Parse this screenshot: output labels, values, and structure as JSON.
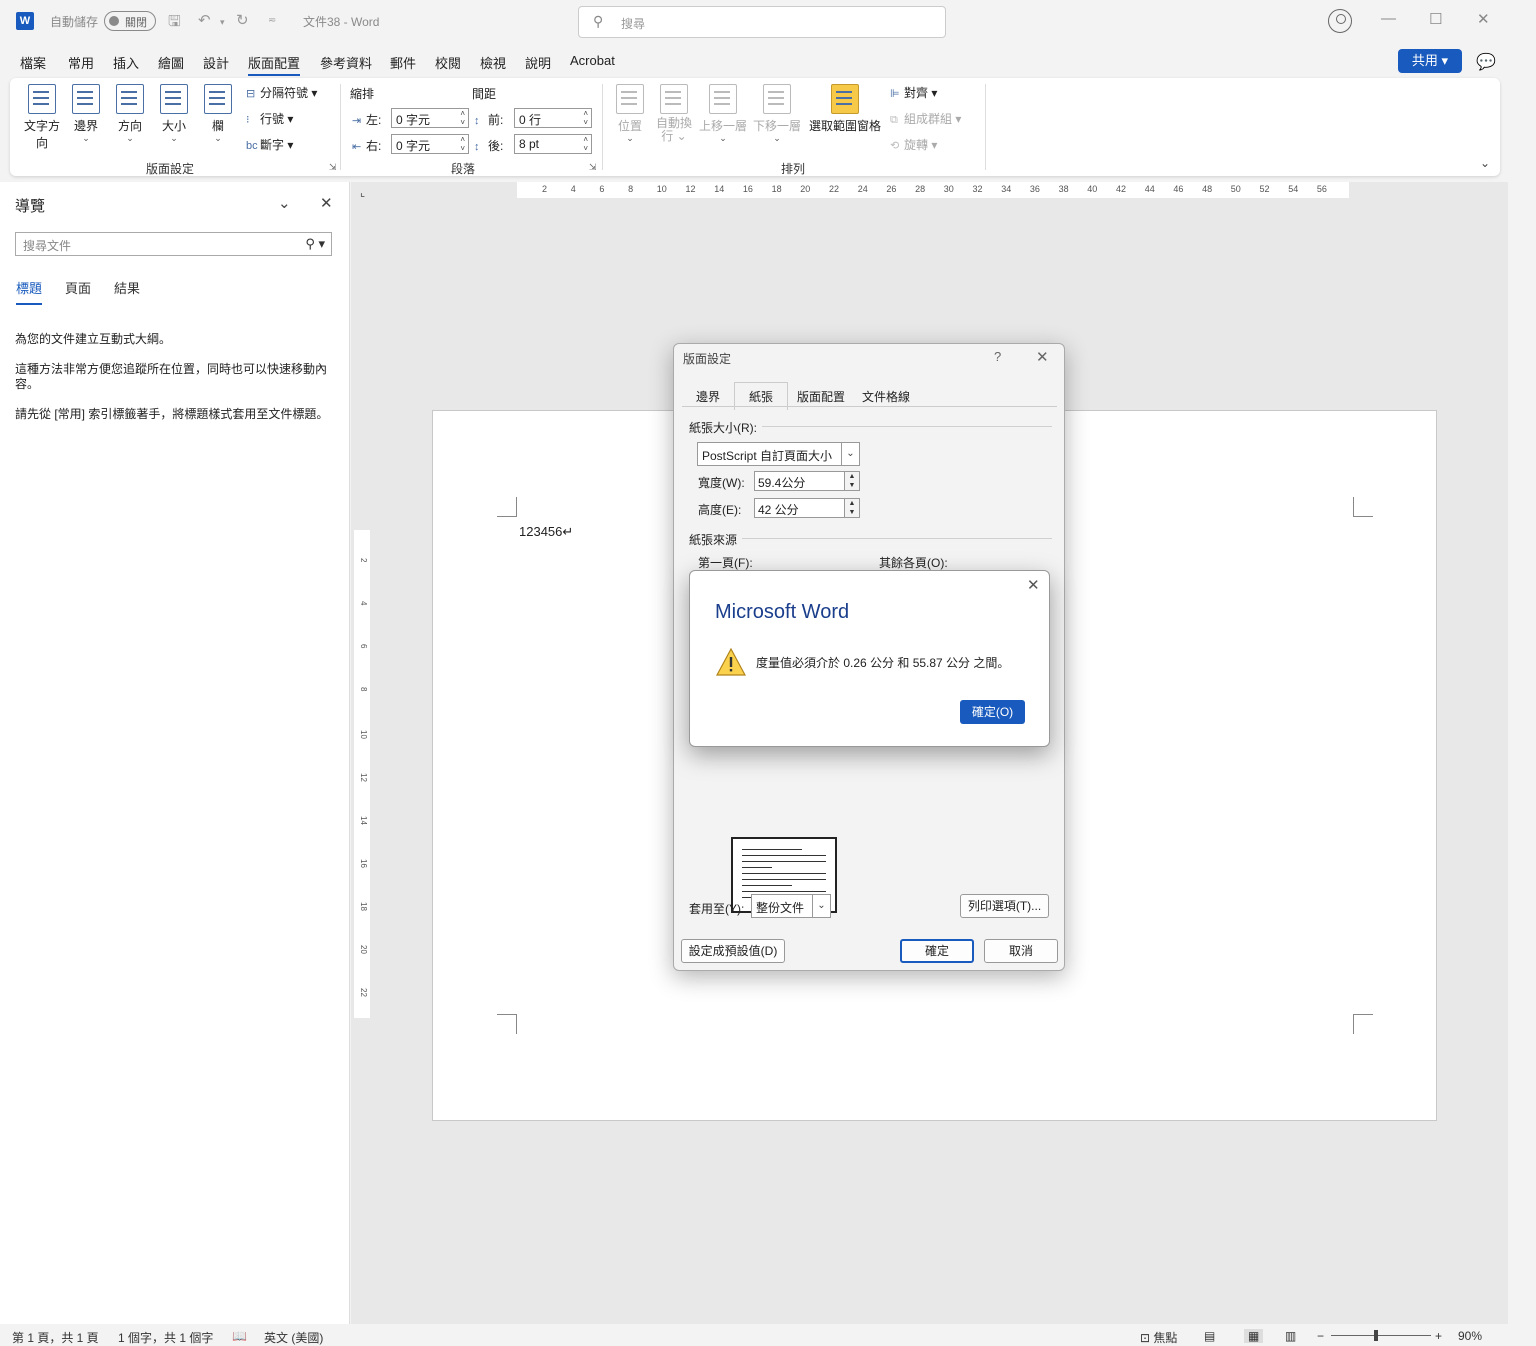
{
  "titlebar": {
    "autosave_label": "自動儲存",
    "autosave_state": "關閉",
    "doc_title": "文件38 - Word",
    "search_placeholder": "搜尋"
  },
  "menu": {
    "tabs": [
      "檔案",
      "常用",
      "插入",
      "繪圖",
      "設計",
      "版面配置",
      "參考資料",
      "郵件",
      "校閱",
      "檢視",
      "說明",
      "Acrobat"
    ],
    "active_tab": "版面配置",
    "share_label": "共用"
  },
  "ribbon": {
    "page_setup": {
      "text_direction": "文字方向",
      "margins": "邊界",
      "orientation": "方向",
      "size": "大小",
      "columns": "欄",
      "breaks": "分隔符號",
      "line_numbers": "行號",
      "hyphenation": "斷字",
      "group_label": "版面設定"
    },
    "paragraph": {
      "indent_title": "縮排",
      "spacing_title": "間距",
      "left_label": "左:",
      "left_value": "0 字元",
      "right_label": "右:",
      "right_value": "0 字元",
      "before_label": "前:",
      "before_value": "0 行",
      "after_label": "後:",
      "after_value": "8 pt",
      "group_label": "段落"
    },
    "arrange": {
      "position": "位置",
      "wrap_text_1": "自動換",
      "wrap_text_2": "行",
      "bring_forward": "上移一層",
      "send_backward": "下移一層",
      "selection_pane": "選取範圍窗格",
      "align": "對齊",
      "group": "組成群組",
      "rotate": "旋轉",
      "group_label": "排列"
    }
  },
  "nav_pane": {
    "title": "導覽",
    "search_placeholder": "搜尋文件",
    "tabs": [
      "標題",
      "頁面",
      "結果"
    ],
    "active_tab": "標題",
    "para1": "為您的文件建立互動式大綱。",
    "para2": "這種方法非常方便您追蹤所在位置，同時也可以快速移動內容。",
    "para3": "請先從 [常用] 索引標籤著手，將標題樣式套用至文件標題。"
  },
  "ruler": {
    "h_ticks": [
      "2",
      "4",
      "6",
      "8",
      "10",
      "12",
      "14",
      "16",
      "18",
      "20",
      "22",
      "24",
      "26",
      "28",
      "30",
      "32",
      "34",
      "36",
      "38",
      "40",
      "42",
      "44",
      "46",
      "48",
      "50",
      "52",
      "54",
      "56"
    ],
    "v_ticks": [
      "2",
      "4",
      "6",
      "8",
      "10",
      "12",
      "14",
      "16",
      "18",
      "20",
      "22"
    ]
  },
  "document": {
    "text": "123456↵"
  },
  "page_setup_dialog": {
    "title": "版面設定",
    "help": "?",
    "tabs": [
      "邊界",
      "紙張",
      "版面配置",
      "文件格線"
    ],
    "active_tab": "紙張",
    "paper_size_section": "紙張大小(R):",
    "paper_size_value": "PostScript 自訂頁面大小",
    "width_label": "寬度(W):",
    "width_value": "59.4公分",
    "height_label": "高度(E):",
    "height_value": "42 公分",
    "paper_source_section": "紙張來源",
    "first_page_label": "第一頁(F):",
    "other_pages_label": "其餘各頁(O):",
    "apply_to_label": "套用至(Y):",
    "apply_to_value": "整份文件",
    "print_options": "列印選項(T)...",
    "set_default": "設定成預設值(D)",
    "ok": "確定",
    "cancel": "取消"
  },
  "alert": {
    "title": "Microsoft Word",
    "message": "度量值必須介於 0.26 公分 和 55.87 公分 之間。",
    "ok": "確定(O)"
  },
  "status": {
    "page": "第 1 頁，共 1 頁",
    "words": "1 個字，共 1 個字",
    "language": "英文 (美國)",
    "focus": "焦點",
    "zoom": "90%"
  },
  "colors": {
    "accent": "#185abd",
    "alert_title": "#1a3e8c"
  }
}
